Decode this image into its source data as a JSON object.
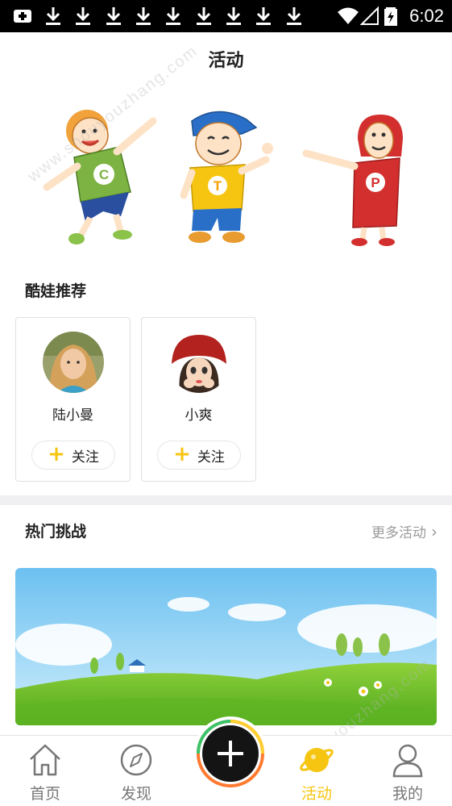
{
  "status_bar": {
    "time": "6:02"
  },
  "header": {
    "title": "活动"
  },
  "banner": {
    "characters": [
      "C",
      "T",
      "P"
    ]
  },
  "recommend": {
    "title": "酷娃推荐",
    "users": [
      {
        "name": "陆小曼",
        "follow_label": "关注"
      },
      {
        "name": "小爽",
        "follow_label": "关注"
      }
    ]
  },
  "hot": {
    "title": "热门挑战",
    "more_label": "更多活动"
  },
  "tabbar": {
    "tabs": [
      {
        "label": "首页",
        "icon": "home-icon"
      },
      {
        "label": "发现",
        "icon": "compass-icon"
      },
      {
        "label": "活动",
        "icon": "planet-icon"
      },
      {
        "label": "我的",
        "icon": "person-icon"
      }
    ],
    "active_tab": "活动"
  },
  "colors": {
    "accent": "#f6c511",
    "muted_text": "#9a9a9a"
  }
}
